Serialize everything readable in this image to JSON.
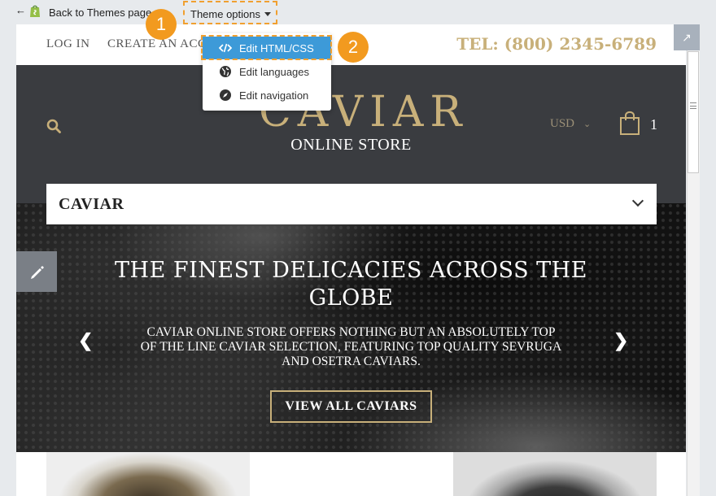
{
  "toolbar": {
    "back_label": "Back to Themes page",
    "theme_options_label": "Theme options"
  },
  "theme_menu": {
    "items": [
      {
        "label": "Edit HTML/CSS",
        "icon": "code-icon",
        "active": true
      },
      {
        "label": "Edit languages",
        "icon": "globe-icon",
        "active": false
      },
      {
        "label": "Edit navigation",
        "icon": "compass-icon",
        "active": false
      }
    ]
  },
  "step_badges": [
    "1",
    "2"
  ],
  "store": {
    "nav": {
      "login": "LOG IN",
      "create_account": "CREATE AN ACCOUNT",
      "phone": "TEL: (800) 2345-6789"
    },
    "header": {
      "logo": "CAVIAR",
      "subtitle": "ONLINE STORE",
      "currency": "USD",
      "cart_count": "1"
    },
    "category_select": "CAVIAR",
    "hero": {
      "title": "THE FINEST DELICACIES ACROSS THE GLOBE",
      "text": "CAVIAR ONLINE STORE OFFERS NOTHING BUT AN ABSOLUTELY TOP OF THE LINE CAVIAR SELECTION, FEATURING TOP QUALITY SEVRUGA AND OSETRA CAVIARS.",
      "cta": "VIEW ALL CAVIARS"
    }
  },
  "colors": {
    "accent_gold": "#c8b07a",
    "header_dark": "#3a3c40",
    "menu_active": "#3d9ad8",
    "badge_orange": "#f29a1f"
  }
}
